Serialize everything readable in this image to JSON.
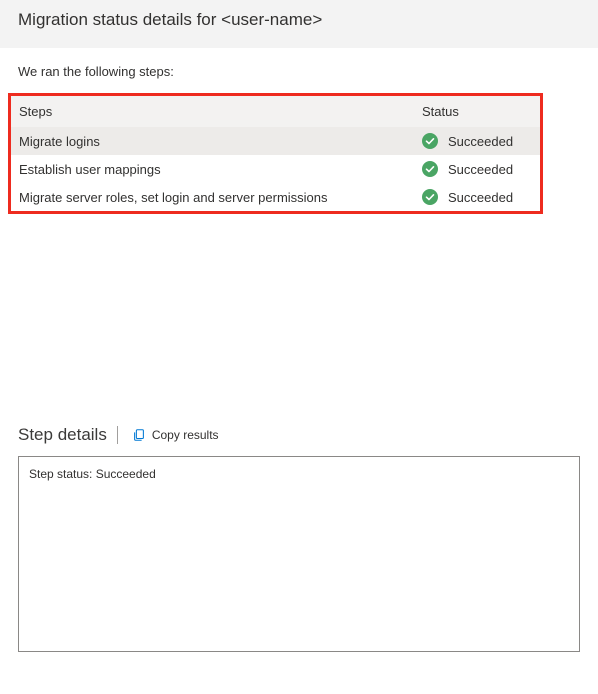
{
  "header": {
    "title": "Migration status details for <user-name>"
  },
  "intro": "We ran the following steps:",
  "table": {
    "headers": {
      "steps": "Steps",
      "status": "Status"
    },
    "rows": [
      {
        "step": "Migrate logins",
        "status": "Succeeded",
        "selected": true
      },
      {
        "step": "Establish user mappings",
        "status": "Succeeded",
        "selected": false
      },
      {
        "step": "Migrate server roles, set login and server permissions",
        "status": "Succeeded",
        "selected": false
      }
    ]
  },
  "details": {
    "title": "Step details",
    "copy_label": "Copy results",
    "status_line": "Step status: Succeeded"
  },
  "colors": {
    "success": "#4aa564",
    "link": "#0078d4",
    "highlight_border": "#ee2b1f"
  }
}
